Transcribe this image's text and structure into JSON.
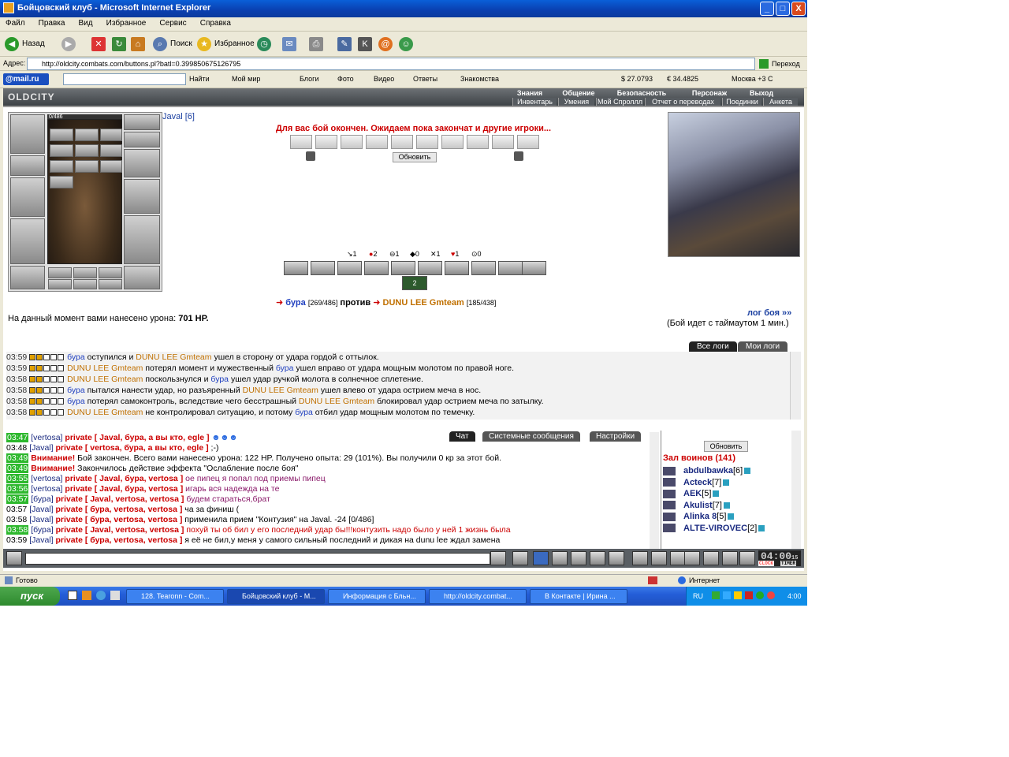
{
  "window": {
    "title": "Бойцовский клуб - Microsoft Internet Explorer",
    "min": "_",
    "max": "□",
    "close": "X"
  },
  "menu": [
    "Файл",
    "Правка",
    "Вид",
    "Избранное",
    "Сервис",
    "Справка"
  ],
  "toolbar": {
    "back": "Назад",
    "search": "Поиск",
    "favorites": "Избранное"
  },
  "address": {
    "label": "Адрес:",
    "url": "http://oldcity.combats.com/buttons.pl?batl=0.399850675126795",
    "go": "Переход"
  },
  "links": {
    "mailru": "@mail.ru",
    "find": "Найти",
    "myworld": "Мой мир",
    "blogs": "Блоги",
    "photo": "Фото",
    "video": "Видео",
    "answers": "Ответы",
    "dating": "Знакомства",
    "usd": "$ 27.0793",
    "eur": "€ 34.4825",
    "city": "Москва +3 С"
  },
  "game": {
    "logo": "OLDCITY",
    "top_tabs": [
      "Знания",
      "Общение",
      "Безопасность",
      "Персонаж",
      "Выход"
    ],
    "sub_tabs": [
      "Инвентарь",
      "Умения",
      "Мой Спроллл",
      "Отчет о переводах",
      "Поединки",
      "Анкета"
    ],
    "hp": "0/486",
    "player": "Javal [6]",
    "battle_msg": "Для вас бой окончен. Ожидаем пока закончат и другие игроки...",
    "refresh": "Обновить",
    "stats": [
      "1",
      "2",
      "1",
      "0",
      "1",
      "1",
      "0"
    ],
    "sel_action": "2",
    "fighter1": "бура",
    "fighter1_hp": "[269/486]",
    "vs": "против",
    "fighter2": "DUNU LEE Gmteam",
    "fighter2_hp": "[185/438]",
    "dmg_text": "На данный момент вами нанесено урона:",
    "dmg_val": "701 HP.",
    "log_link": "лог боя »»",
    "timeout": "(Бой идет с таймаутом 1 мин.)",
    "log_tabs": [
      "Все логи",
      "Мои логи"
    ],
    "log_lines": [
      {
        "t": "03:59",
        "p1": "бура",
        "c1": "blue",
        "a": "оступился и",
        "p2": "DUNU LEE Gmteam",
        "c2": "orange",
        "b": "ушел в сторону от удара гордой с оттылок."
      },
      {
        "t": "03:59",
        "p1": "DUNU LEE Gmteam",
        "c1": "orange",
        "a": "потерял момент и мужественный",
        "p2": "бура",
        "c2": "blue",
        "b": "ушел вправо от удара мощным молотом по правой ноге."
      },
      {
        "t": "03:58",
        "p1": "DUNU LEE Gmteam",
        "c1": "orange",
        "a": "поскользнулся и",
        "p2": "бура",
        "c2": "blue",
        "b": "ушел удар ручкой молота в солнечное сплетение."
      },
      {
        "t": "03:58",
        "p1": "бура",
        "c1": "blue",
        "a": "пытался нанести удар, но разъяренный",
        "p2": "DUNU LEE Gmteam",
        "c2": "orange",
        "b": "ушел влево от удара острием меча в нос."
      },
      {
        "t": "03:58",
        "p1": "бура",
        "c1": "blue",
        "a": "потерял самоконтроль, вследствие чего бесстрашный",
        "p2": "DUNU LEE Gmteam",
        "c2": "orange",
        "b": "блокировал удар острием меча по затылку."
      },
      {
        "t": "03:58",
        "p1": "DUNU LEE Gmteam",
        "c1": "orange",
        "a": "не контролировал ситуацию, и потому",
        "p2": "бура",
        "c2": "blue",
        "b": "отбил удар мощным молотом по темечку."
      }
    ],
    "chat_tabs": [
      "Чат",
      "Системные сообщения",
      "Настройки"
    ],
    "chat_lines": [
      {
        "t": "03:47",
        "tag": true,
        "who": "[vertosa]",
        "pv": "private [ Javal, бура, а вы кто, egle ]",
        "msg": "☻☻☻",
        "mc": "blue"
      },
      {
        "t": "03:48",
        "tag": false,
        "who": "[Javal]",
        "pv": "private [ vertosa, бура, а вы кто, egle ]",
        "msg": ";-)",
        "mc": "black"
      },
      {
        "t": "03:49",
        "tag": true,
        "who": "",
        "pv": "Внимание!",
        "msg": "Бой закончен. Всего вами нанесено урона: 122 HP. Получено опыта: 29 (101%). Вы получили 0 кр за этот бой.",
        "mc": "black"
      },
      {
        "t": "03:49",
        "tag": true,
        "who": "",
        "pv": "Внимание!",
        "msg": "Закончилось действие эффекта \"Ослабление после боя\"",
        "mc": "black"
      },
      {
        "t": "03:55",
        "tag": true,
        "who": "[vertosa]",
        "pv": "private [ Javal, бура, vertosa ]",
        "msg": "ое пипец я попал под приемы пипец",
        "mc": "purple"
      },
      {
        "t": "03:56",
        "tag": true,
        "who": "[vertosa]",
        "pv": "private [ Javal, бура, vertosa ]",
        "msg": "игарь вся надежда на те",
        "mc": "purple"
      },
      {
        "t": "03:57",
        "tag": true,
        "who": "[бура]",
        "pv": "private [ Javal, vertosa, vertosa ]",
        "msg": "будем стараться,брат",
        "mc": "purple"
      },
      {
        "t": "03:57",
        "tag": false,
        "who": "[Javal]",
        "pv": "private [ бура, vertosa, vertosa ]",
        "msg": "ча за финиш (",
        "mc": "black"
      },
      {
        "t": "03:58",
        "tag": false,
        "who": "[Javal]",
        "pv": "private [ бура, vertosa, vertosa ]",
        "msg": "применила прием \"Контузия\" на Javal. -24 [0/486]",
        "mc": "black"
      },
      {
        "t": "03:58",
        "tag": true,
        "who": "[бура]",
        "pv": "private [ Javal, vertosa, vertosa ]",
        "msg": "похуй ты об бил у его последний удар бы!!!контузить надо было у ней 1 жизнь была",
        "mc": "red"
      },
      {
        "t": "03:59",
        "tag": false,
        "who": "[Javal]",
        "pv": "private [ бура, vertosa, vertosa ]",
        "msg": "я её не бил,у меня у самого сильный последний и дикая на dunu lee ждал замена",
        "mc": "black"
      }
    ],
    "users_refresh": "Обновить",
    "hall_title": "Зал воинов (141)",
    "users": [
      {
        "name": "abdulbawka",
        "lvl": "[6]"
      },
      {
        "name": "Acteck",
        "lvl": "[7]"
      },
      {
        "name": "AEK",
        "lvl": "[5]"
      },
      {
        "name": "Akulist",
        "lvl": "[7]"
      },
      {
        "name": "Alinka 8",
        "lvl": "[5]"
      },
      {
        "name": "ALTE-VIROVEC",
        "lvl": "[2]"
      }
    ],
    "clock": "04:00",
    "clock_s": "15",
    "clock_lbl": "CLOCK",
    "timer_lbl": "TIMER"
  },
  "status": {
    "done": "Готово",
    "zone": "Интернет"
  },
  "taskbar": {
    "start": "пуск",
    "tasks": [
      "128. Tearonn - Com...",
      "Бойцовский клуб - M...",
      "Информация с Бльн...",
      "http://oldcity.combat...",
      "В Контакте | Ирина ..."
    ],
    "lang": "RU",
    "time": "4:00"
  }
}
